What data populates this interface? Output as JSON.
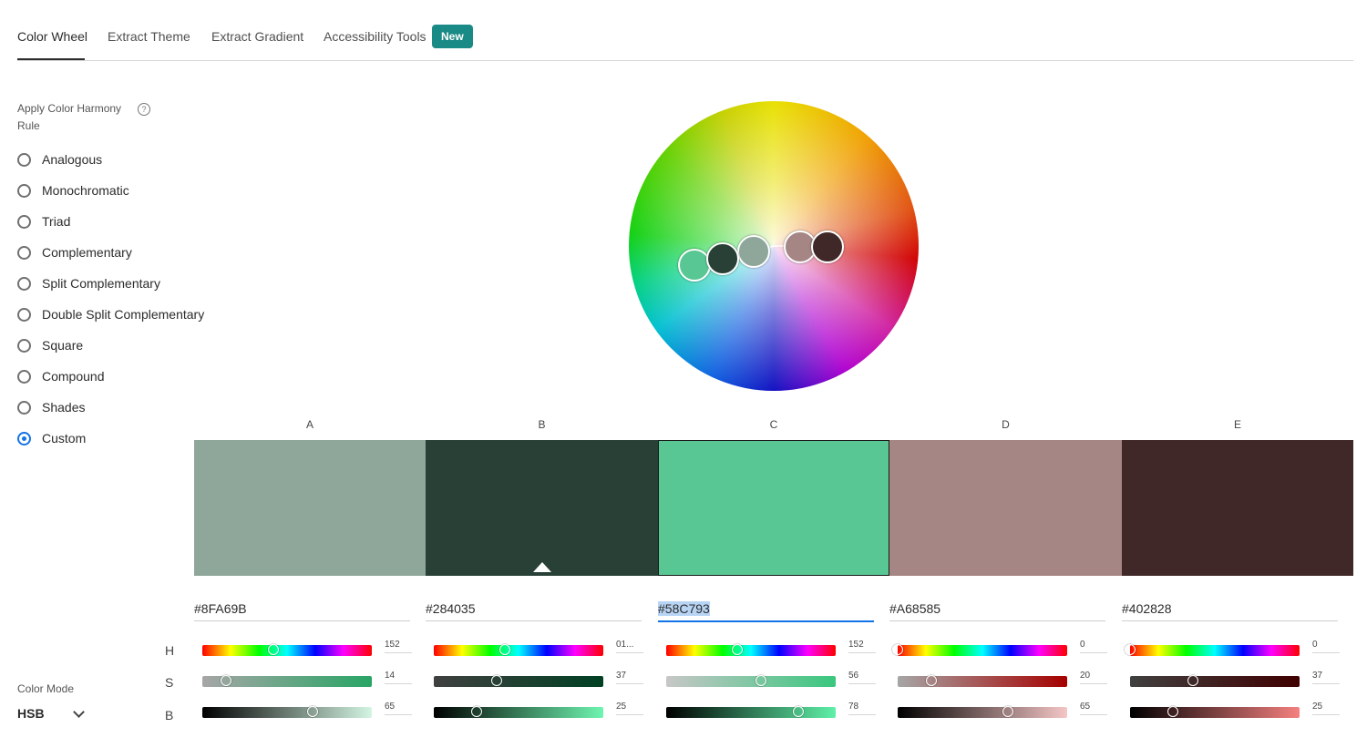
{
  "tabs": [
    {
      "label": "Color Wheel",
      "active": true
    },
    {
      "label": "Extract Theme",
      "active": false
    },
    {
      "label": "Extract Gradient",
      "active": false
    },
    {
      "label": "Accessibility Tools",
      "active": false
    }
  ],
  "new_badge": "New",
  "harmony": {
    "label": "Apply Color Harmony Rule",
    "help_icon": "question-icon",
    "options": [
      {
        "label": "Analogous",
        "checked": false
      },
      {
        "label": "Monochromatic",
        "checked": false
      },
      {
        "label": "Triad",
        "checked": false
      },
      {
        "label": "Complementary",
        "checked": false
      },
      {
        "label": "Split Complementary",
        "checked": false
      },
      {
        "label": "Double Split Complementary",
        "checked": false
      },
      {
        "label": "Square",
        "checked": false
      },
      {
        "label": "Compound",
        "checked": false
      },
      {
        "label": "Shades",
        "checked": false
      },
      {
        "label": "Custom",
        "checked": true
      }
    ]
  },
  "palette": [
    {
      "letter": "A",
      "hex": "#8FA69B",
      "color": "#8FA69B",
      "h": "152",
      "s": "14",
      "b": "65",
      "h_frac": 0.42,
      "s_frac": 0.14,
      "b_frac": 0.65
    },
    {
      "letter": "B",
      "hex": "#284035",
      "color": "#284035",
      "h": "01...",
      "s": "37",
      "b": "25",
      "h_frac": 0.42,
      "s_frac": 0.37,
      "b_frac": 0.25
    },
    {
      "letter": "C",
      "hex": "#58C793",
      "color": "#58C793",
      "h": "152",
      "s": "56",
      "b": "78",
      "h_frac": 0.42,
      "s_frac": 0.56,
      "b_frac": 0.78
    },
    {
      "letter": "D",
      "hex": "#A68585",
      "color": "#A68585",
      "h": "0",
      "s": "20",
      "b": "65",
      "h_frac": 0.0,
      "s_frac": 0.2,
      "b_frac": 0.65
    },
    {
      "letter": "E",
      "hex": "#402828",
      "color": "#402828",
      "h": "0",
      "s": "37",
      "b": "25",
      "h_frac": 0.0,
      "s_frac": 0.37,
      "b_frac": 0.25
    }
  ],
  "selected_swatch": "C",
  "base_swatch": "B",
  "row_labels": {
    "h": "H",
    "s": "S",
    "b": "B"
  },
  "color_mode": {
    "label": "Color Mode",
    "value": "HSB",
    "icon": "chevron-down-icon"
  }
}
